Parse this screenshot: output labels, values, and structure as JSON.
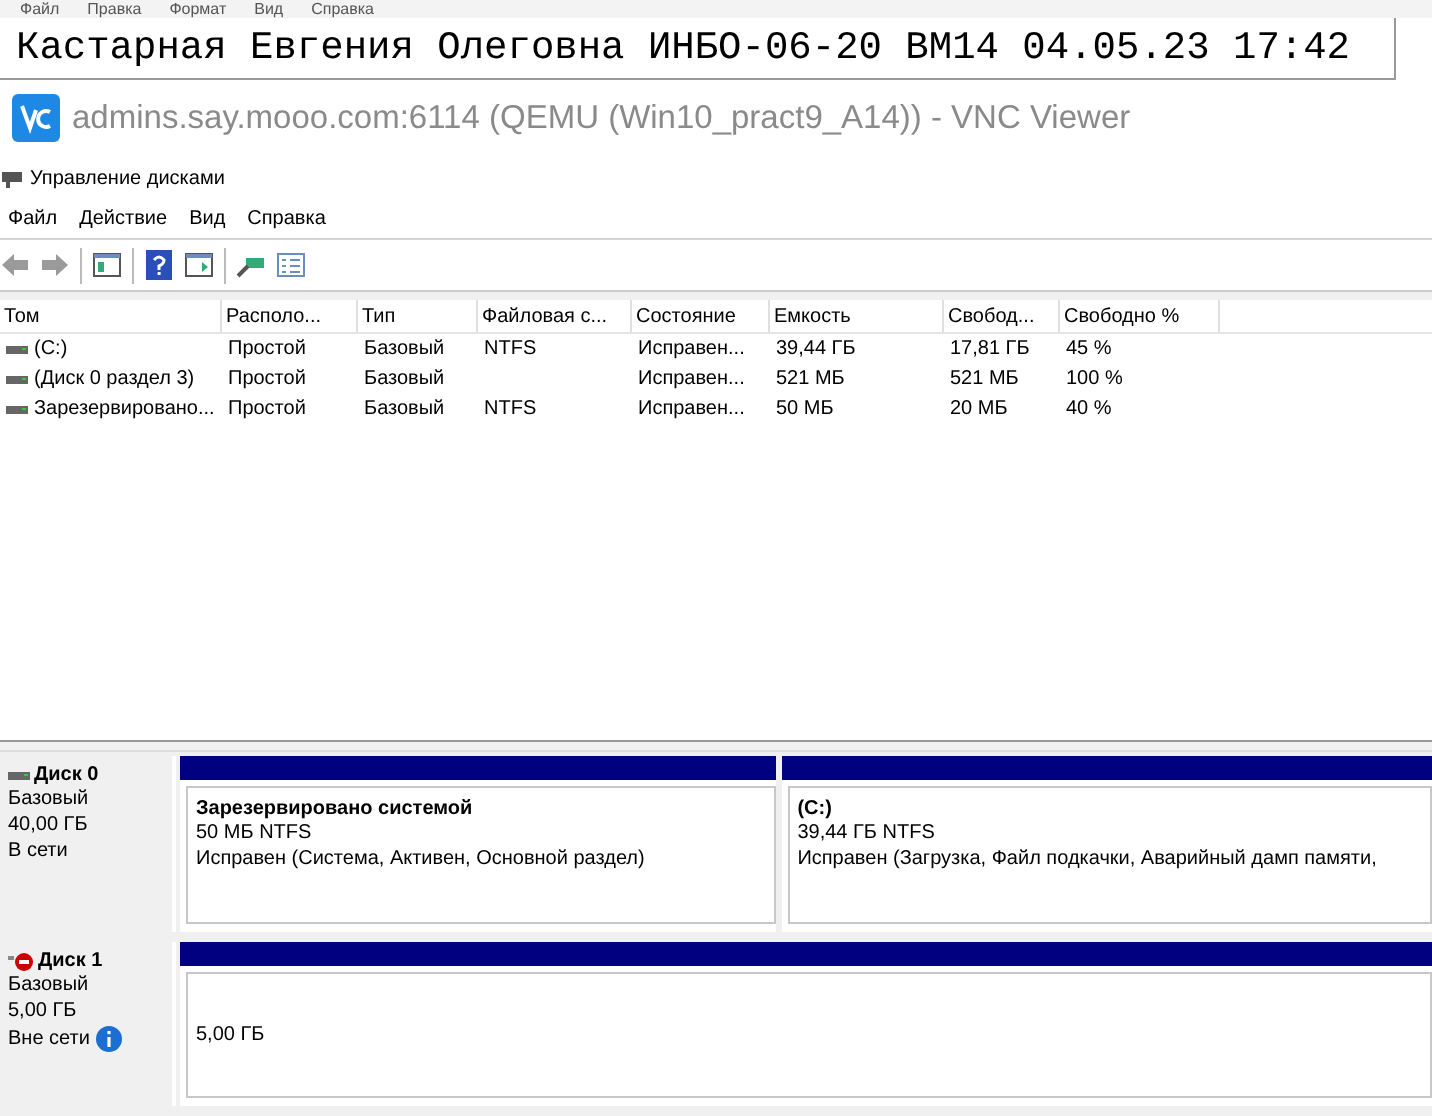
{
  "host_menu": [
    "Файл",
    "Правка",
    "Формат",
    "Вид",
    "Справка"
  ],
  "caption": "Кастарная Евгения Олеговна ИНБО-06-20 ВМ14 04.05.23 17:42",
  "vnc_window": {
    "title": "admins.say.mooo.com:6114 (QEMU (Win10_pract9_A14)) - VNC Viewer"
  },
  "mmc": {
    "title": "Управление дисками",
    "menu": [
      "Файл",
      "Действие",
      "Вид",
      "Справка"
    ]
  },
  "volumes_table": {
    "columns": [
      "Том",
      "Располо...",
      "Тип",
      "Файловая с...",
      "Состояние",
      "Емкость",
      "Свобод...",
      "Свободно %"
    ],
    "rows": [
      {
        "cells": [
          "(C:)",
          "Простой",
          "Базовый",
          "NTFS",
          "Исправен...",
          "39,44 ГБ",
          "17,81 ГБ",
          "45 %"
        ]
      },
      {
        "cells": [
          "(Диск 0 раздел 3)",
          "Простой",
          "Базовый",
          "",
          "Исправен...",
          "521 МБ",
          "521 МБ",
          "100 %"
        ]
      },
      {
        "cells": [
          "Зарезервировано...",
          "Простой",
          "Базовый",
          "NTFS",
          "Исправен...",
          "50 МБ",
          "20 МБ",
          "40 %"
        ]
      }
    ]
  },
  "disks": [
    {
      "name": "Диск 0",
      "type": "Базовый",
      "size": "40,00 ГБ",
      "status": "В сети",
      "online": true,
      "partitions": [
        {
          "kind": "volume",
          "name": "Зарезервировано системой",
          "detail": "50 МБ NTFS",
          "state": "Исправен (Система, Активен, Основной раздел)"
        },
        {
          "kind": "volume",
          "name": "(C:)",
          "detail": "39,44 ГБ NTFS",
          "state": "Исправен (Загрузка, Файл подкачки, Аварийный дамп памяти,"
        }
      ]
    },
    {
      "name": "Диск 1",
      "type": "Базовый",
      "size": "5,00 ГБ",
      "status": "Вне сети",
      "online": false,
      "partitions": [
        {
          "kind": "unknown",
          "detail": "5,00 ГБ"
        }
      ]
    }
  ]
}
